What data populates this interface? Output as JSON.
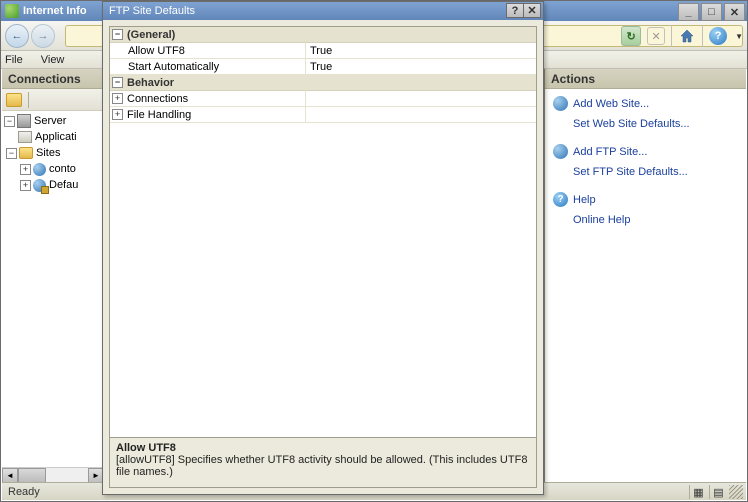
{
  "window": {
    "title": "Internet Info",
    "min_label": "_",
    "max_label": "□",
    "close_label": "✕"
  },
  "menu": {
    "file": "File",
    "view": "View"
  },
  "connections": {
    "header": "Connections",
    "server": "Server",
    "app_pools": "Applicati",
    "sites": "Sites",
    "site1": "conto",
    "site2": "Defau"
  },
  "actions": {
    "header": "Actions",
    "add_web": "Add Web Site...",
    "set_web": "Set Web Site Defaults...",
    "add_ftp": "Add FTP Site...",
    "set_ftp": "Set FTP Site Defaults...",
    "help": "Help",
    "online_help": "Online Help"
  },
  "status": {
    "ready": "Ready"
  },
  "dialog": {
    "title": "FTP Site Defaults",
    "help_btn": "?",
    "close_btn": "✕",
    "categories": {
      "general": "(General)",
      "behavior": "Behavior"
    },
    "props": {
      "allow_utf8": {
        "label": "Allow UTF8",
        "value": "True"
      },
      "start_auto": {
        "label": "Start Automatically",
        "value": "True"
      },
      "connections": {
        "label": "Connections",
        "value": ""
      },
      "file_handling": {
        "label": "File Handling",
        "value": ""
      }
    },
    "help": {
      "title": "Allow UTF8",
      "desc": "[allowUTF8] Specifies whether UTF8 activity should be allowed. (This includes UTF8 file names.)"
    }
  }
}
